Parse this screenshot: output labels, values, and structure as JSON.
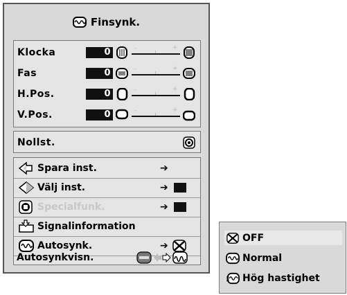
{
  "menu": {
    "title": "Finsynk.",
    "title_icon": "fine-sync-icon",
    "adjust": [
      {
        "label": "Klocka",
        "value": "0"
      },
      {
        "label": "Fas",
        "value": "0"
      },
      {
        "label": "H.Pos.",
        "value": "0"
      },
      {
        "label": "V.Pos.",
        "value": "0"
      }
    ],
    "slider_minus": "–",
    "slider_plus": "+",
    "reset_label": "Nollst.",
    "items": [
      {
        "label": "Spara inst.",
        "arrow": "➔"
      },
      {
        "label": "Välj inst.",
        "arrow": "➔"
      },
      {
        "label": "Specialfunk.",
        "arrow": "➔"
      },
      {
        "label": "Signalinformation"
      },
      {
        "label": "Autosynk.",
        "arrow": "➔"
      }
    ],
    "autosync_display_label": "Autosynkvisn."
  },
  "submenu": {
    "options": [
      "OFF",
      "Normal",
      "Hög hastighet"
    ],
    "selected": "OFF"
  },
  "colors": {
    "menu_bg": "#d9d9d9",
    "text": "#000000",
    "disabled": "#c8c8c8"
  }
}
